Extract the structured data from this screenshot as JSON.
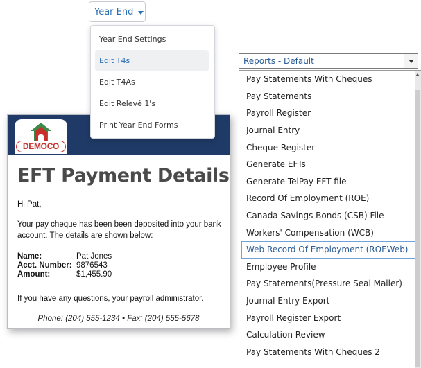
{
  "year_end": {
    "button_label": "Year End",
    "menu_items": [
      "Year End Settings",
      "Edit T4s",
      "Edit T4As",
      "Edit Relevé 1's",
      "Print Year End Forms"
    ]
  },
  "email": {
    "logo_text": "DEMOCO",
    "title": "EFT Payment Details",
    "greeting": "Hi Pat,",
    "message": "Your pay cheque has been been deposited into your bank account. The details are shown below:",
    "details": {
      "name_label": "Name:",
      "name_value": "Pat Jones",
      "acct_label": "Acct. Number:",
      "acct_value": "9876543",
      "amount_label": "Amount:",
      "amount_value": "$1,455.90"
    },
    "questions": "If you have any questions, your payroll administrator.",
    "footer": "Phone: (204) 555-1234 • Fax: (204) 555-5678",
    "colors": {
      "header": "#1f3a66",
      "logo_red": "#c7302a",
      "logo_green": "#3e8a4b"
    }
  },
  "reports": {
    "selected_value": "Reports - Default",
    "items": [
      "Pay Statements With Cheques",
      "Pay Statements",
      "Payroll Register",
      "Journal Entry",
      "Cheque Register",
      "Generate EFTs",
      "Generate TelPay EFT file",
      "Record Of Employment (ROE)",
      "Canada Savings Bonds (CSB) File",
      "Workers' Compensation (WCB)",
      "Web Record Of Employment (ROEWeb)",
      "Employee Profile",
      "Pay Statements(Pressure Seal Mailer)",
      "Journal Entry Export",
      "Payroll Register Export",
      "Calculation Review",
      "Pay Statements With Cheques 2"
    ],
    "highlighted": "Web Record Of Employment (ROEWeb)"
  }
}
